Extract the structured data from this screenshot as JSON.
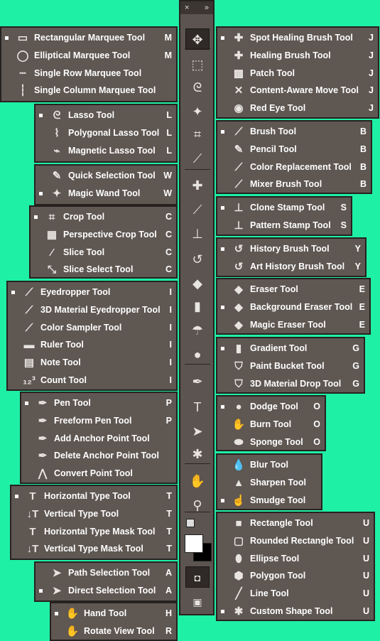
{
  "toolbar": {
    "header_close": "×",
    "header_expand": "»",
    "tools": [
      "move-icon",
      "marquee-icon",
      "lasso-icon",
      "magic-wand-icon",
      "crop-icon",
      "eyedropper-icon",
      "spot-healing-icon",
      "brush-icon",
      "clone-stamp-icon",
      "history-brush-icon",
      "eraser-icon",
      "gradient-icon",
      "blur-icon",
      "dodge-icon",
      "pen-icon",
      "type-icon",
      "path-selection-icon",
      "custom-shape-icon",
      "hand-icon",
      "zoom-icon"
    ],
    "foreground_color": "#ffffff",
    "background_color": "#000000"
  },
  "groups": {
    "marquee": [
      {
        "label": "Rectangular Marquee Tool",
        "key": "M",
        "active": true,
        "icon": "▭"
      },
      {
        "label": "Elliptical Marquee Tool",
        "key": "M",
        "active": false,
        "icon": "◯"
      },
      {
        "label": "Single Row Marquee Tool",
        "key": "",
        "active": false,
        "icon": "┄"
      },
      {
        "label": "Single Column Marquee Tool",
        "key": "",
        "active": false,
        "icon": "┆"
      }
    ],
    "lasso": [
      {
        "label": "Lasso Tool",
        "key": "L",
        "active": true,
        "icon": "ᘓ"
      },
      {
        "label": "Polygonal Lasso Tool",
        "key": "L",
        "active": false,
        "icon": "⌇"
      },
      {
        "label": "Magnetic Lasso Tool",
        "key": "L",
        "active": false,
        "icon": "⌁"
      }
    ],
    "selection": [
      {
        "label": "Quick Selection Tool",
        "key": "W",
        "active": false,
        "icon": "✎"
      },
      {
        "label": "Magic Wand Tool",
        "key": "W",
        "active": true,
        "icon": "✦"
      }
    ],
    "crop": [
      {
        "label": "Crop Tool",
        "key": "C",
        "active": true,
        "icon": "⌗"
      },
      {
        "label": "Perspective Crop Tool",
        "key": "C",
        "active": false,
        "icon": "▦"
      },
      {
        "label": "Slice Tool",
        "key": "C",
        "active": false,
        "icon": "⁄"
      },
      {
        "label": "Slice Select Tool",
        "key": "C",
        "active": false,
        "icon": "⤡"
      }
    ],
    "eyedropper": [
      {
        "label": "Eyedropper Tool",
        "key": "I",
        "active": true,
        "icon": "⟋"
      },
      {
        "label": "3D Material Eyedropper Tool",
        "key": "I",
        "active": false,
        "icon": "⟋"
      },
      {
        "label": "Color Sampler Tool",
        "key": "I",
        "active": false,
        "icon": "⟋"
      },
      {
        "label": "Ruler Tool",
        "key": "I",
        "active": false,
        "icon": "▬"
      },
      {
        "label": "Note Tool",
        "key": "I",
        "active": false,
        "icon": "▤"
      },
      {
        "label": "Count Tool",
        "key": "I",
        "active": false,
        "icon": "₁₂³"
      }
    ],
    "pen": [
      {
        "label": "Pen Tool",
        "key": "P",
        "active": true,
        "icon": "✒"
      },
      {
        "label": "Freeform Pen Tool",
        "key": "P",
        "active": false,
        "icon": "✒"
      },
      {
        "label": "Add Anchor Point Tool",
        "key": "",
        "active": false,
        "icon": "✒"
      },
      {
        "label": "Delete Anchor Point Tool",
        "key": "",
        "active": false,
        "icon": "✒"
      },
      {
        "label": "Convert Point Tool",
        "key": "",
        "active": false,
        "icon": "⋀"
      }
    ],
    "type": [
      {
        "label": "Horizontal Type Tool",
        "key": "T",
        "active": true,
        "icon": "T"
      },
      {
        "label": "Vertical Type Tool",
        "key": "T",
        "active": false,
        "icon": "↓T"
      },
      {
        "label": "Horizontal Type Mask Tool",
        "key": "T",
        "active": false,
        "icon": "T"
      },
      {
        "label": "Vertical Type Mask Tool",
        "key": "T",
        "active": false,
        "icon": "↓T"
      }
    ],
    "path_selection": [
      {
        "label": "Path Selection Tool",
        "key": "A",
        "active": false,
        "icon": "➤"
      },
      {
        "label": "Direct Selection Tool",
        "key": "A",
        "active": true,
        "icon": "➤"
      }
    ],
    "hand": [
      {
        "label": "Hand Tool",
        "key": "H",
        "active": true,
        "icon": "✋"
      },
      {
        "label": "Rotate View Tool",
        "key": "R",
        "active": false,
        "icon": "✋"
      }
    ],
    "healing": [
      {
        "label": "Spot Healing Brush Tool",
        "key": "J",
        "active": true,
        "icon": "✚"
      },
      {
        "label": "Healing Brush Tool",
        "key": "J",
        "active": false,
        "icon": "✚"
      },
      {
        "label": "Patch Tool",
        "key": "J",
        "active": false,
        "icon": "▩"
      },
      {
        "label": "Content-Aware Move Tool",
        "key": "J",
        "active": false,
        "icon": "✕"
      },
      {
        "label": "Red Eye Tool",
        "key": "J",
        "active": false,
        "icon": "◉"
      }
    ],
    "brush": [
      {
        "label": "Brush Tool",
        "key": "B",
        "active": true,
        "icon": "⟋"
      },
      {
        "label": "Pencil Tool",
        "key": "B",
        "active": false,
        "icon": "✎"
      },
      {
        "label": "Color Replacement Tool",
        "key": "B",
        "active": false,
        "icon": "⟋"
      },
      {
        "label": "Mixer Brush Tool",
        "key": "B",
        "active": false,
        "icon": "⟋"
      }
    ],
    "stamp": [
      {
        "label": "Clone Stamp Tool",
        "key": "S",
        "active": true,
        "icon": "⊥"
      },
      {
        "label": "Pattern Stamp Tool",
        "key": "S",
        "active": false,
        "icon": "⊥"
      }
    ],
    "history": [
      {
        "label": "History Brush Tool",
        "key": "Y",
        "active": true,
        "icon": "↺"
      },
      {
        "label": "Art History Brush Tool",
        "key": "Y",
        "active": false,
        "icon": "↺"
      }
    ],
    "eraser": [
      {
        "label": "Eraser Tool",
        "key": "E",
        "active": false,
        "icon": "◆"
      },
      {
        "label": "Background Eraser Tool",
        "key": "E",
        "active": true,
        "icon": "◆"
      },
      {
        "label": "Magic Eraser Tool",
        "key": "E",
        "active": false,
        "icon": "◆"
      }
    ],
    "gradient": [
      {
        "label": "Gradient Tool",
        "key": "G",
        "active": true,
        "icon": "▮"
      },
      {
        "label": "Paint Bucket Tool",
        "key": "G",
        "active": false,
        "icon": "⛉"
      },
      {
        "label": "3D Material Drop Tool",
        "key": "G",
        "active": false,
        "icon": "⛉"
      }
    ],
    "dodge": [
      {
        "label": "Dodge Tool",
        "key": "O",
        "active": true,
        "icon": "●"
      },
      {
        "label": "Burn Tool",
        "key": "O",
        "active": false,
        "icon": "✋"
      },
      {
        "label": "Sponge Tool",
        "key": "O",
        "active": false,
        "icon": "⬬"
      }
    ],
    "blur": [
      {
        "label": "Blur Tool",
        "key": "",
        "active": false,
        "icon": "💧"
      },
      {
        "label": "Sharpen Tool",
        "key": "",
        "active": false,
        "icon": "▲"
      },
      {
        "label": "Smudge Tool",
        "key": "",
        "active": true,
        "icon": "☝"
      }
    ],
    "shape": [
      {
        "label": "Rectangle Tool",
        "key": "U",
        "active": false,
        "icon": "■"
      },
      {
        "label": "Rounded Rectangle Tool",
        "key": "U",
        "active": false,
        "icon": "▢"
      },
      {
        "label": "Ellipse Tool",
        "key": "U",
        "active": false,
        "icon": "⬮"
      },
      {
        "label": "Polygon Tool",
        "key": "U",
        "active": false,
        "icon": "⬢"
      },
      {
        "label": "Line Tool",
        "key": "U",
        "active": false,
        "icon": "╱"
      },
      {
        "label": "Custom Shape Tool",
        "key": "U",
        "active": true,
        "icon": "✱"
      }
    ]
  }
}
